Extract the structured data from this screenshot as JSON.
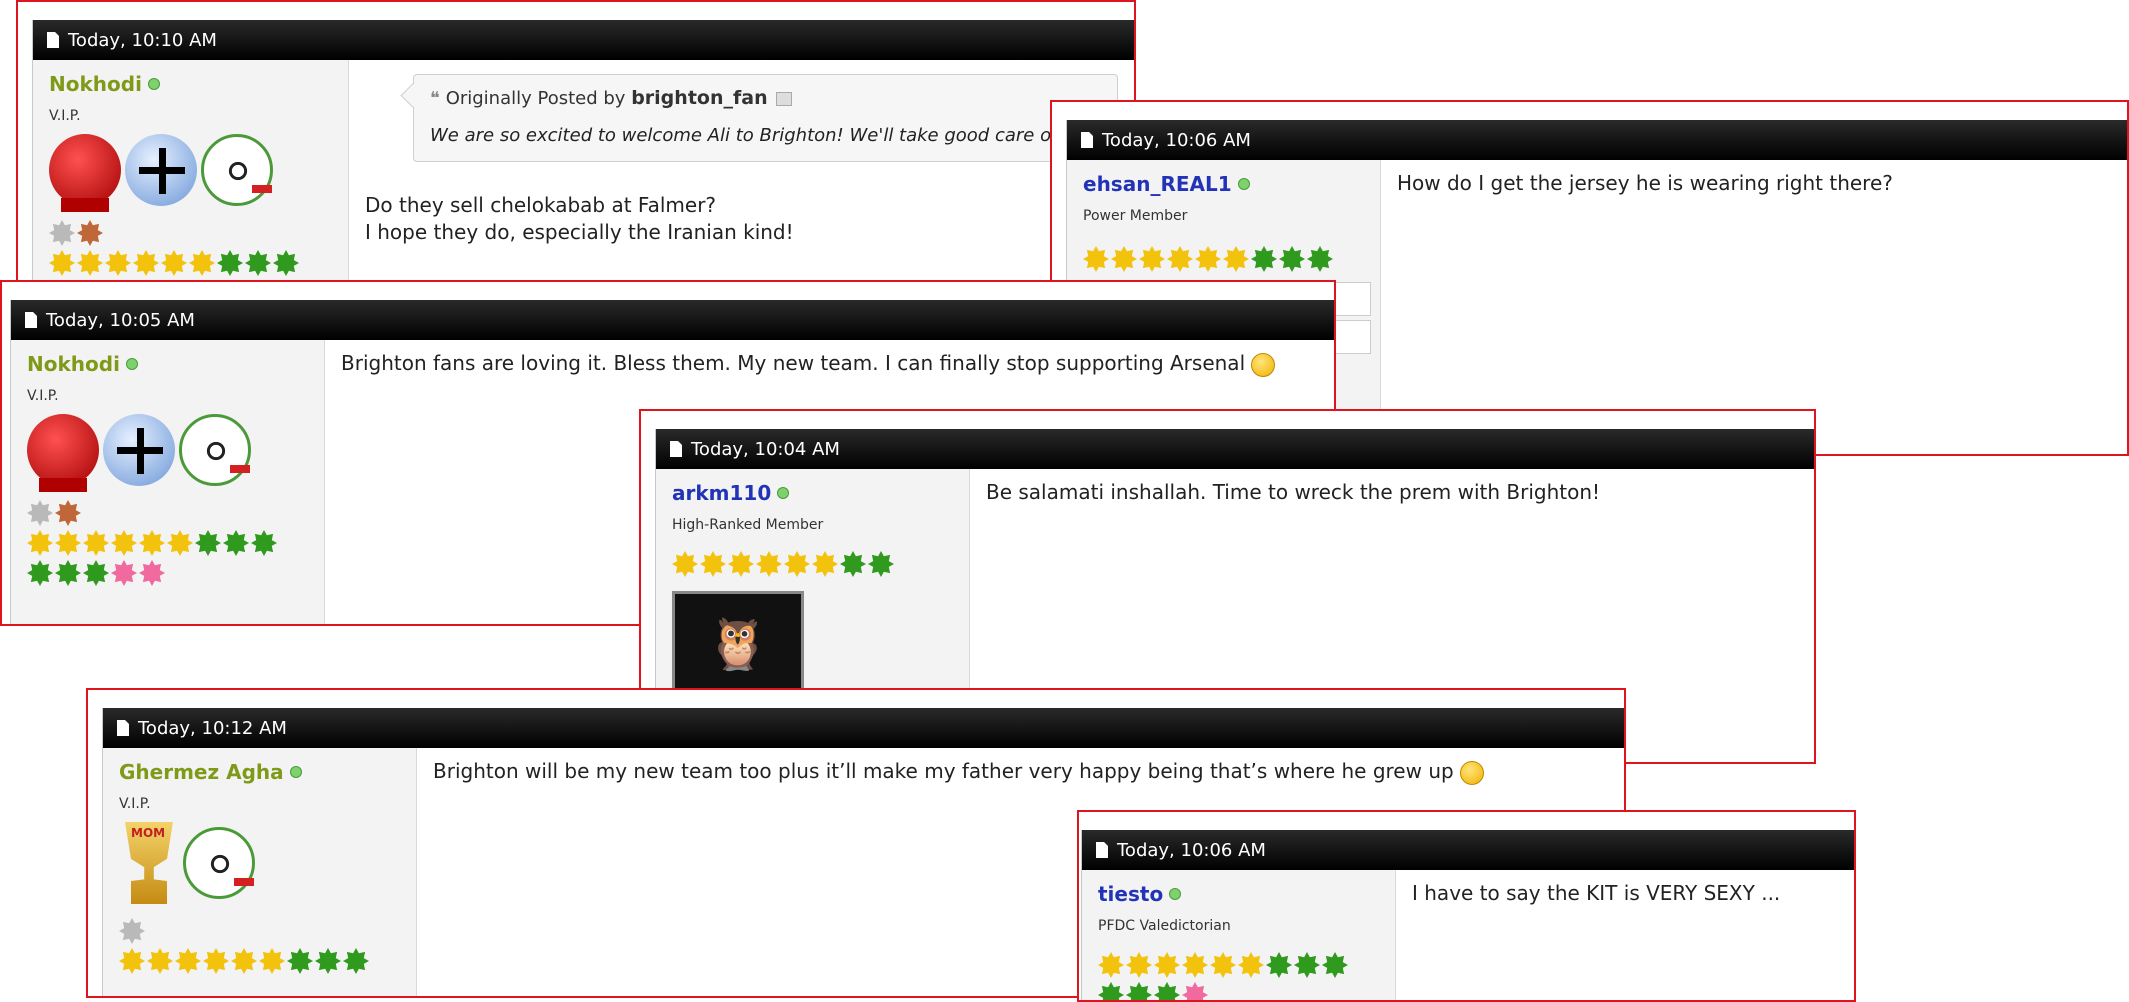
{
  "colors": {
    "frame": "#e0141e",
    "header": "#000000",
    "vip_name": "#7f9a18",
    "member_name": "#2233b8"
  },
  "posts": [
    {
      "time": "Today, 10:10 AM",
      "username": "Nokhodi",
      "usertitle": "V.I.P.",
      "quote": {
        "label": "Originally Posted by",
        "author": "brighton_fan",
        "text": "We are so excited to welcome Ali to Brighton! We'll take good care of"
      },
      "line1": "Do they sell chelokabab at Falmer?",
      "line2": "I hope they do, especially the Iranian kind!"
    },
    {
      "time": "Today, 10:06 AM",
      "username": "ehsan_REAL1",
      "usertitle": "Power Member",
      "text": "How do I get the jersey he is wearing right there?"
    },
    {
      "time": "Today, 10:05 AM",
      "username": "Nokhodi",
      "usertitle": "V.I.P.",
      "text": "Brighton fans are loving it. Bless them. My new team. I can finally stop supporting Arsenal"
    },
    {
      "time": "Today, 10:04 AM",
      "username": "arkm110",
      "usertitle": "High-Ranked Member",
      "text": "Be salamati inshallah. Time to wreck the prem with Brighton!"
    },
    {
      "time": "Today, 10:12 AM",
      "username": "Ghermez Agha",
      "usertitle": "V.I.P.",
      "text": "Brighton will be my new team too plus it’ll make my father very happy being that’s where he grew up",
      "trophy_text": "MOM"
    },
    {
      "time": "Today, 10:06 AM",
      "username": "tiesto",
      "usertitle": "PFDC Valedictorian",
      "text": "I have to say the KIT is VERY SEXY ..."
    }
  ]
}
